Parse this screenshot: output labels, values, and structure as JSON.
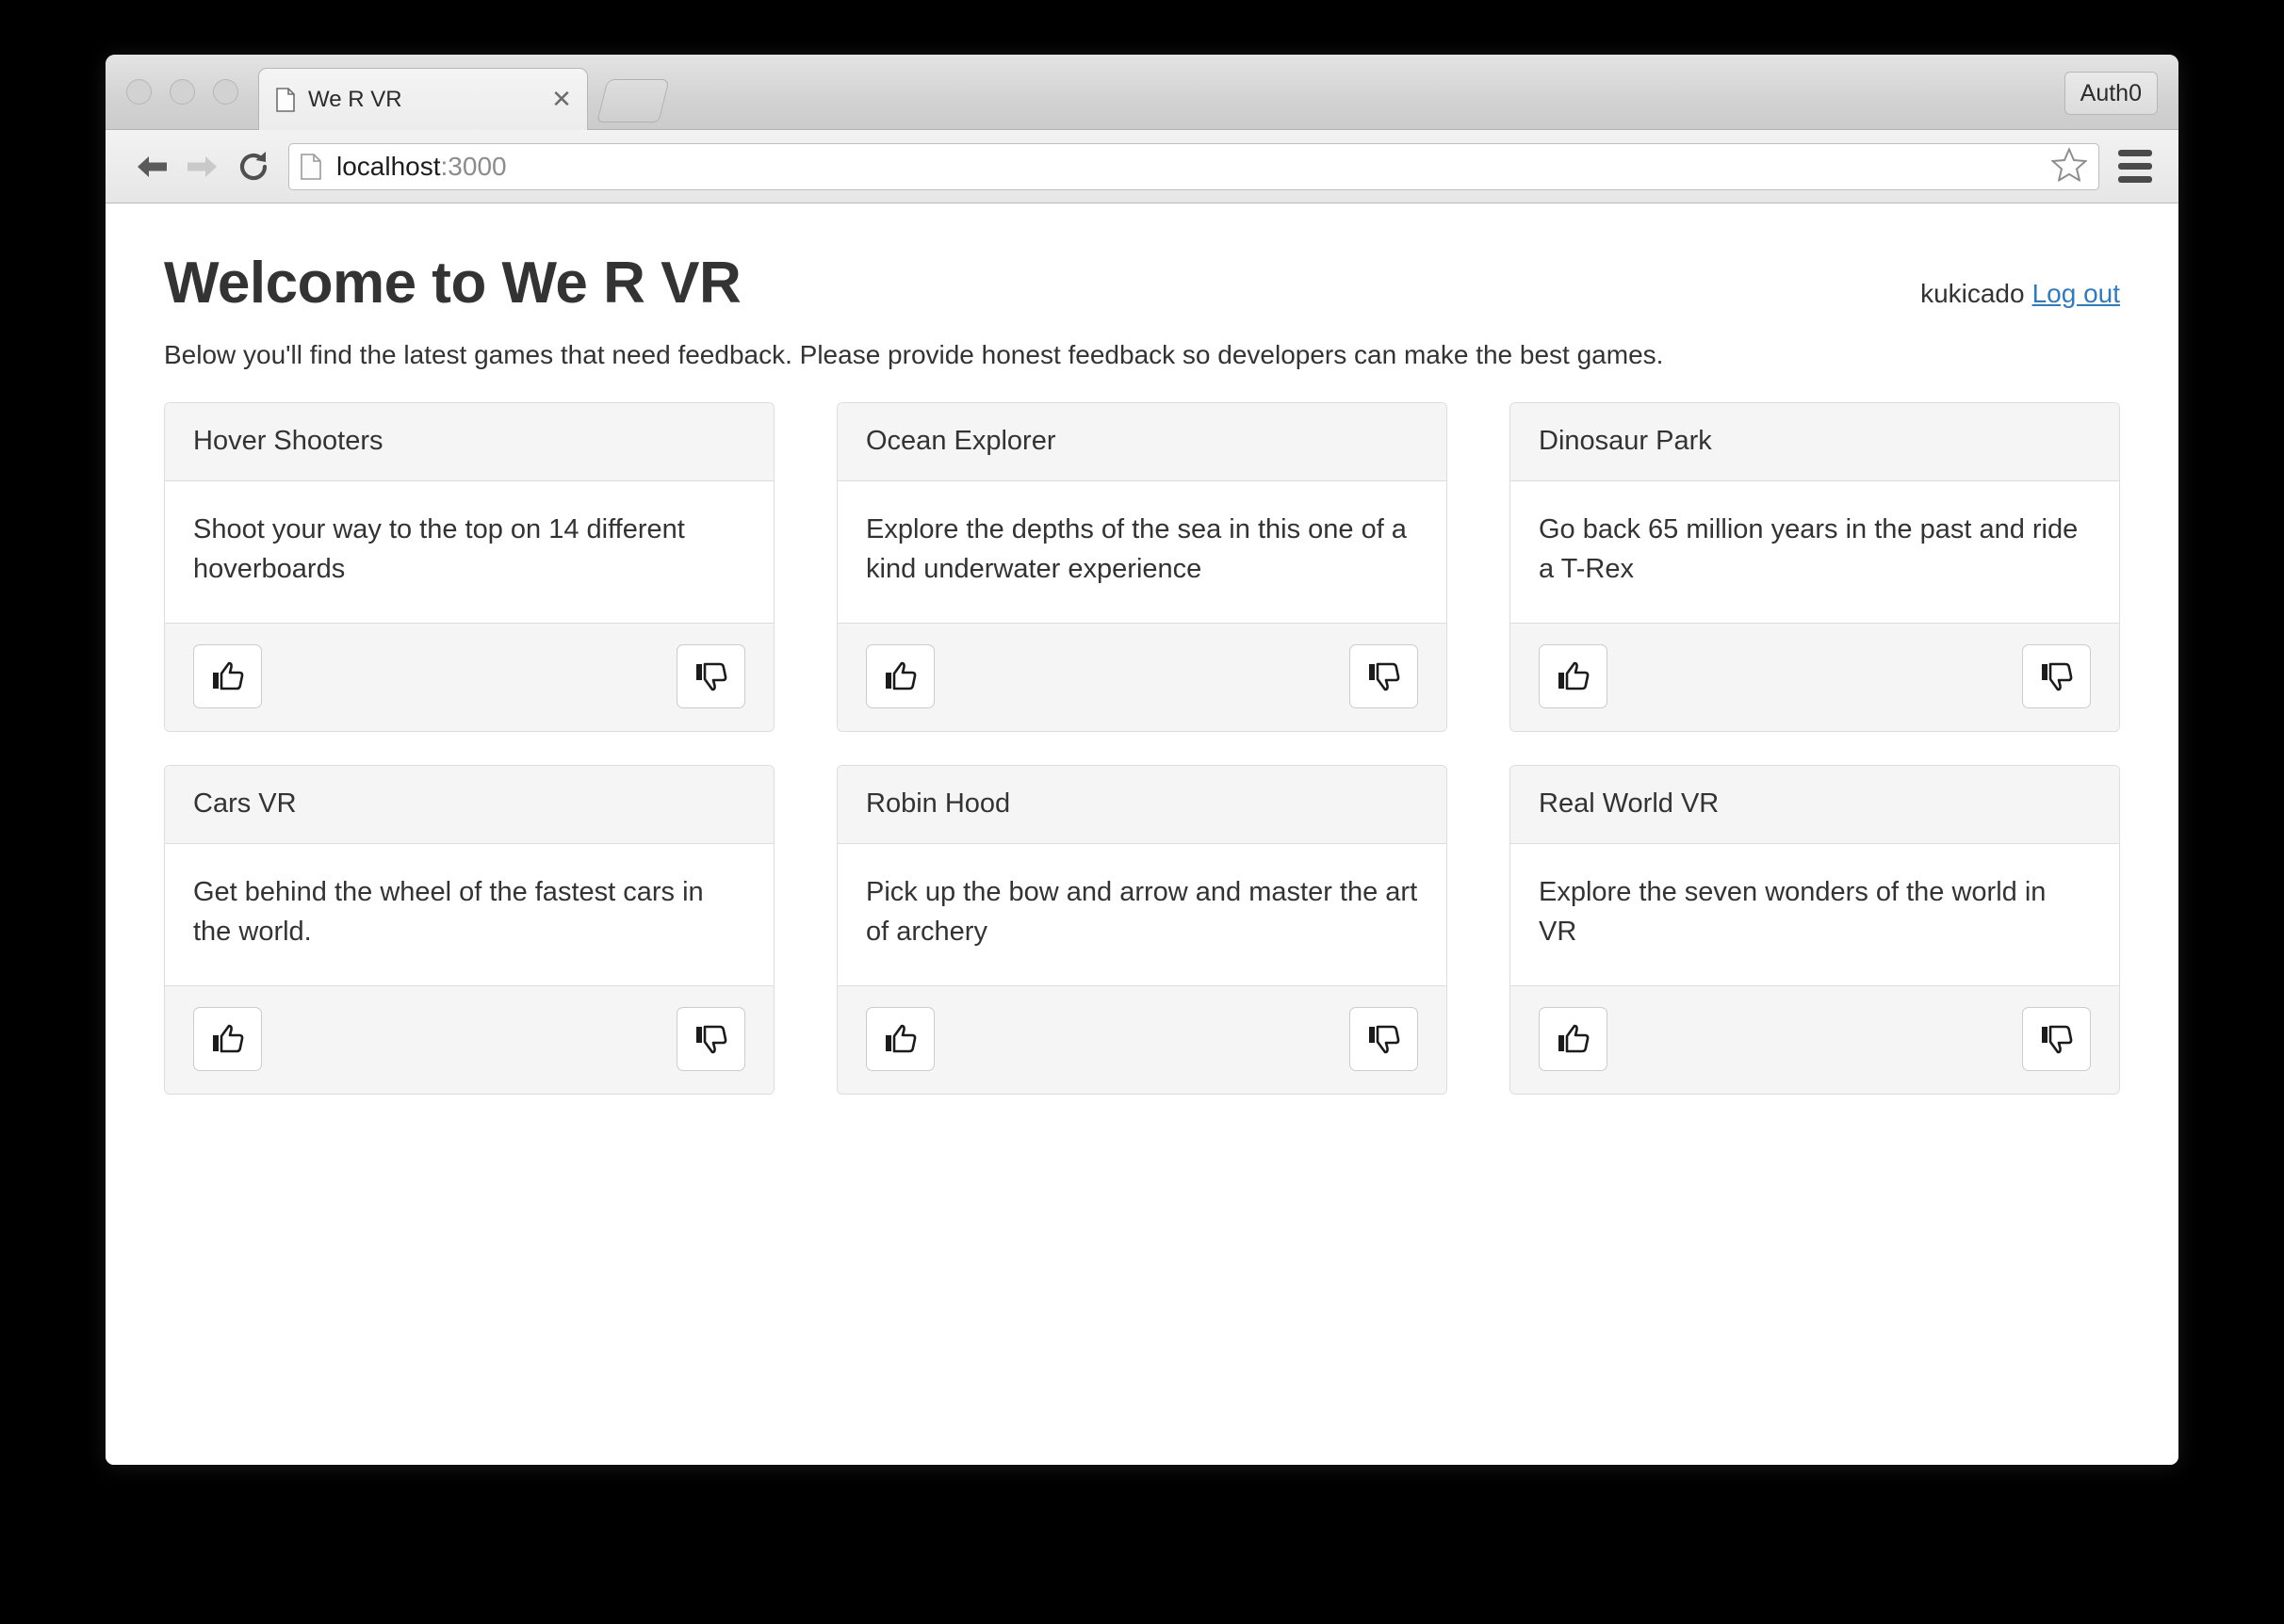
{
  "browser": {
    "tab": {
      "title": "We R VR",
      "favicon_icon": "document-icon",
      "close_icon": "close-icon"
    },
    "new_tab_icon": "new-tab-icon",
    "extension_button": {
      "label": "Auth0"
    },
    "toolbar": {
      "back_icon": "back-arrow-icon",
      "forward_icon": "forward-arrow-icon",
      "reload_icon": "reload-icon",
      "url_favicon_icon": "document-icon",
      "url_host": "localhost",
      "url_port": ":3000",
      "bookmark_icon": "star-icon",
      "menu_icon": "hamburger-menu-icon"
    },
    "window_controls": [
      "close-button",
      "minimize-button",
      "maximize-button"
    ]
  },
  "page": {
    "title": "Welcome to We R VR",
    "username": "kukicado",
    "logout_label": "Log out",
    "subtitle": "Below you'll find the latest games that need feedback. Please provide honest feedback so developers can make the best games.",
    "vote_up_icon": "thumbs-up-icon",
    "vote_down_icon": "thumbs-down-icon",
    "accent_link_color": "#337ab7",
    "cards": [
      {
        "title": "Hover Shooters",
        "description": "Shoot your way to the top on 14 different hoverboards"
      },
      {
        "title": "Ocean Explorer",
        "description": "Explore the depths of the sea in this one of a kind underwater experience"
      },
      {
        "title": "Dinosaur Park",
        "description": "Go back 65 million years in the past and ride a T-Rex"
      },
      {
        "title": "Cars VR",
        "description": "Get behind the wheel of the fastest cars in the world."
      },
      {
        "title": "Robin Hood",
        "description": "Pick up the bow and arrow and master the art of archery"
      },
      {
        "title": "Real World VR",
        "description": "Explore the seven wonders of the world in VR"
      }
    ]
  }
}
